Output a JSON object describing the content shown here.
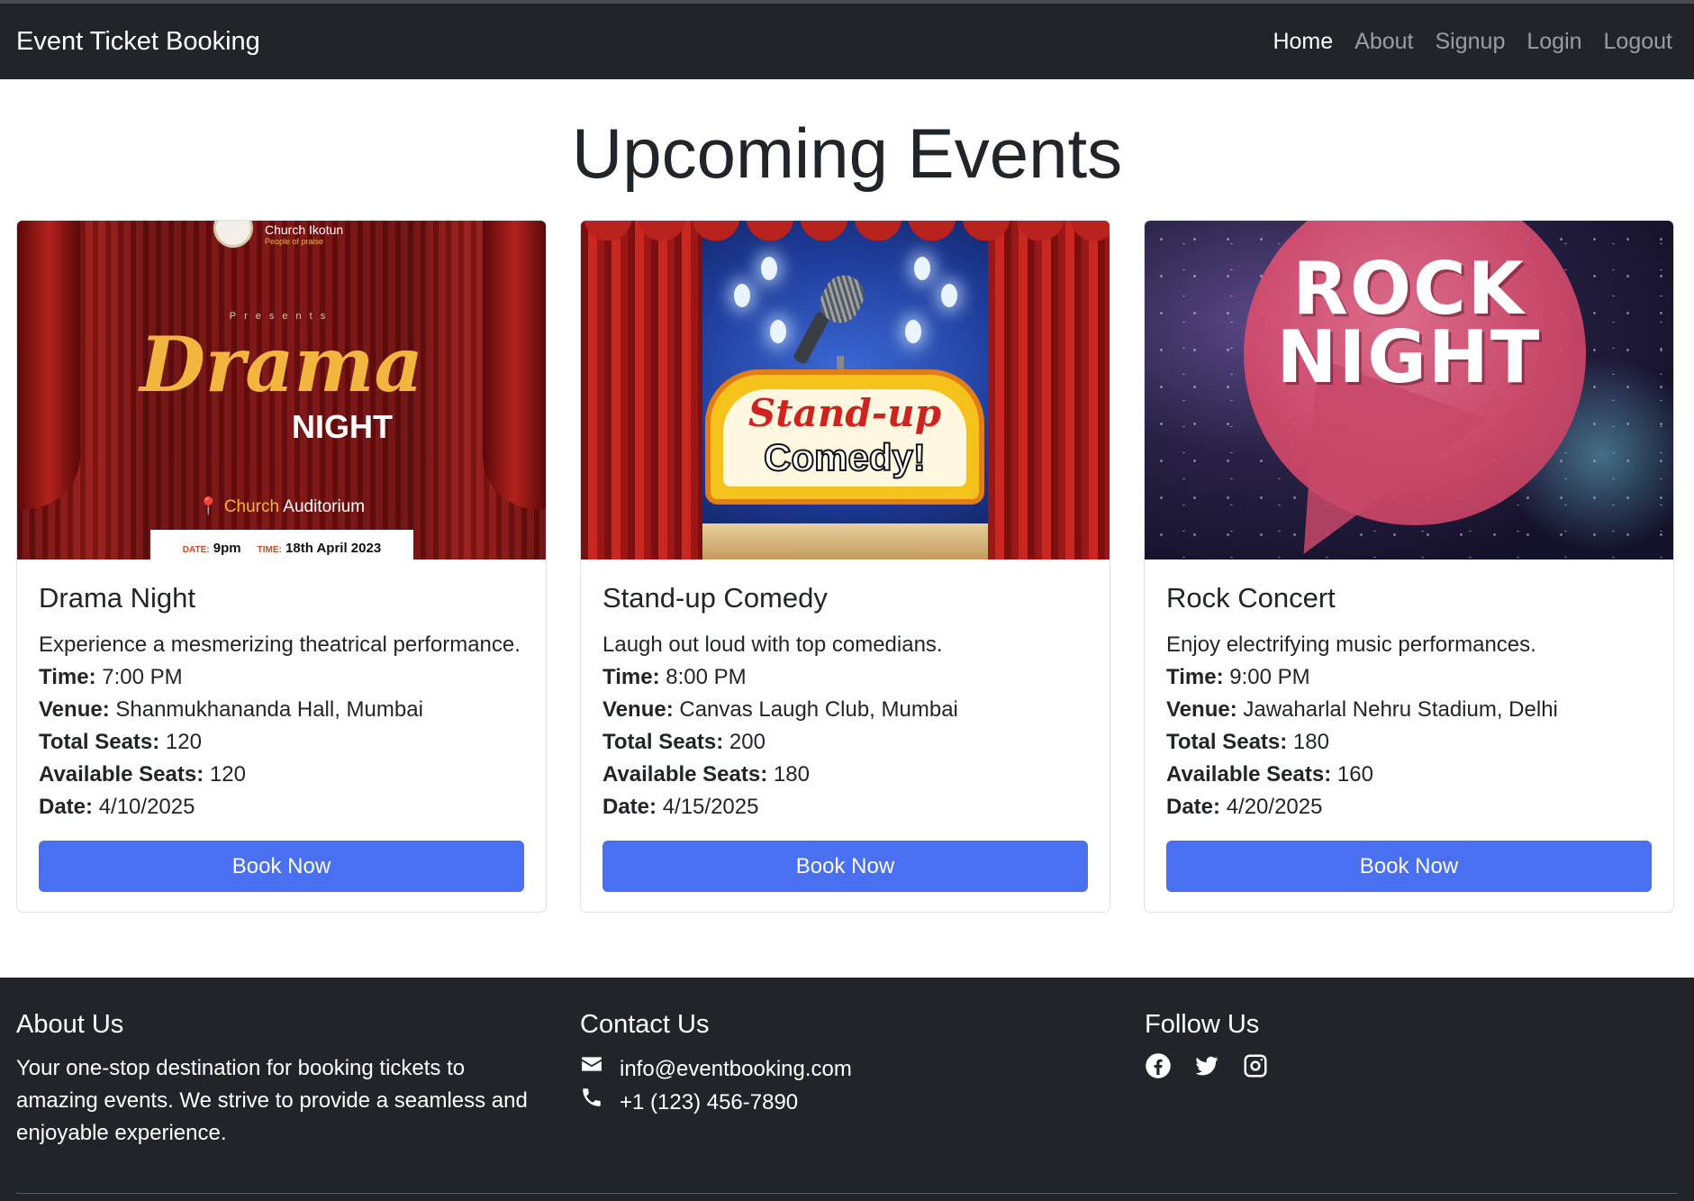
{
  "navbar": {
    "brand": "Event Ticket Booking",
    "links": [
      {
        "label": "Home",
        "active": true
      },
      {
        "label": "About",
        "active": false
      },
      {
        "label": "Signup",
        "active": false
      },
      {
        "label": "Login",
        "active": false
      },
      {
        "label": "Logout",
        "active": false
      }
    ]
  },
  "page_title": "Upcoming Events",
  "labels": {
    "time": "Time:",
    "venue": "Venue:",
    "total_seats": "Total Seats:",
    "available_seats": "Available Seats:",
    "date": "Date:"
  },
  "events": [
    {
      "title": "Drama Night",
      "description": "Experience a mesmerizing theatrical performance.",
      "time": "7:00 PM",
      "venue": "Shanmukhananda Hall, Mumbai",
      "total_seats": "120",
      "available_seats": "120",
      "date": "4/10/2025",
      "button": "Book Now",
      "image": {
        "org": "Church Ikotun",
        "org_tagline": "People of praise",
        "presents": "Presents",
        "headline": "Drama",
        "subheadline": "NIGHT",
        "venue_a": "Church",
        "venue_b": "Auditorium",
        "date_label": "DATE:",
        "date_value": "9pm",
        "time_label": "TIME:",
        "time_value": "18th April 2023"
      }
    },
    {
      "title": "Stand-up Comedy",
      "description": "Laugh out loud with top comedians.",
      "time": "8:00 PM",
      "venue": "Canvas Laugh Club, Mumbai",
      "total_seats": "200",
      "available_seats": "180",
      "date": "4/15/2025",
      "button": "Book Now",
      "image": {
        "line1": "Stand-up",
        "line2": "Comedy!"
      }
    },
    {
      "title": "Rock Concert",
      "description": "Enjoy electrifying music performances.",
      "time": "9:00 PM",
      "venue": "Jawaharlal Nehru Stadium, Delhi",
      "total_seats": "180",
      "available_seats": "160",
      "date": "4/20/2025",
      "button": "Book Now",
      "image": {
        "line1": "ROCK",
        "line2": "NIGHT"
      }
    }
  ],
  "footer": {
    "about": {
      "heading": "About Us",
      "text": "Your one-stop destination for booking tickets to amazing events. We strive to provide a seamless and enjoyable experience."
    },
    "contact": {
      "heading": "Contact Us",
      "email": "info@eventbooking.com",
      "phone": "+1 (123) 456-7890",
      "email_icon": "envelope-icon",
      "phone_icon": "phone-icon"
    },
    "follow": {
      "heading": "Follow Us",
      "icons": [
        "facebook-icon",
        "twitter-icon",
        "instagram-icon"
      ]
    }
  },
  "colors": {
    "navbar_bg": "#212529",
    "button_bg": "#4870f0",
    "footer_bg": "#212529"
  }
}
